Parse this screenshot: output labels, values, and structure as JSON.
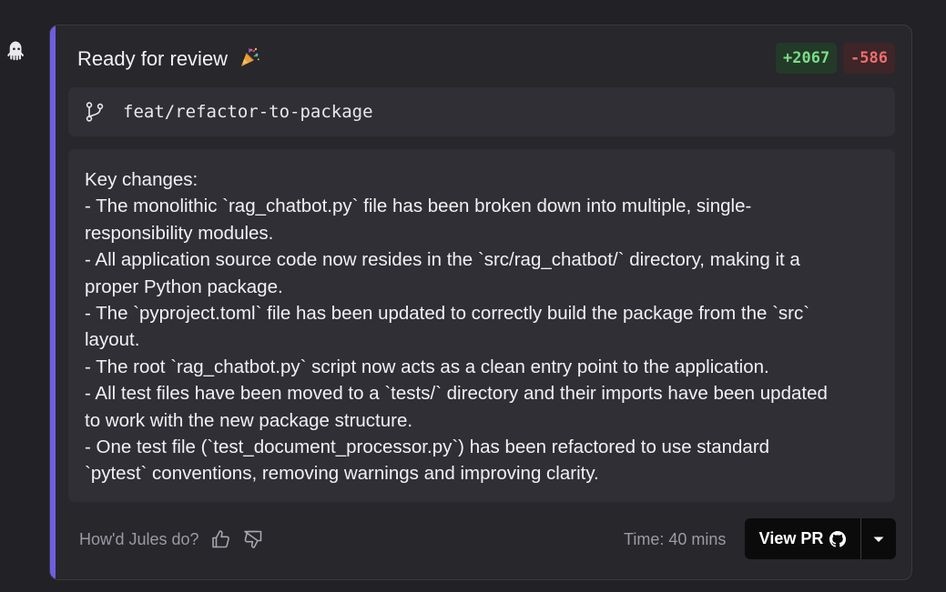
{
  "card": {
    "title": "Ready for review",
    "title_emoji": "party-popper-icon",
    "additions": "+2067",
    "deletions": "-586",
    "accent_color": "#6d5fe0"
  },
  "branch": {
    "icon": "git-branch-icon",
    "name": "feat/refactor-to-package"
  },
  "summary": {
    "lines": [
      "Key changes:",
      "- The monolithic `rag_chatbot.py` file has been broken down into multiple, single-",
      "responsibility modules.",
      "- All application source code now resides in the `src/rag_chatbot/` directory, making it a",
      "proper Python package.",
      "- The `pyproject.toml` file has been updated to correctly build the package from the `src`",
      "layout.",
      "- The root `rag_chatbot.py` script now acts as a clean entry point to the application.",
      "- All test files have been moved to a `tests/` directory and their imports have been updated",
      "to work with the new package structure.",
      "- One test file (`test_document_processor.py`) has been refactored to use standard",
      "`pytest` conventions, removing warnings and improving clarity."
    ]
  },
  "footer": {
    "feedback_label": "How'd Jules do?",
    "thumbs_up_icon": "thumbs-up-icon",
    "thumbs_down_icon": "thumbs-down-icon",
    "time_label": "Time: 40 mins",
    "view_pr_label": "View PR",
    "view_pr_icon": "github-icon",
    "dropdown_icon": "caret-down-icon"
  },
  "agent": {
    "avatar_icon": "octopus-icon"
  }
}
